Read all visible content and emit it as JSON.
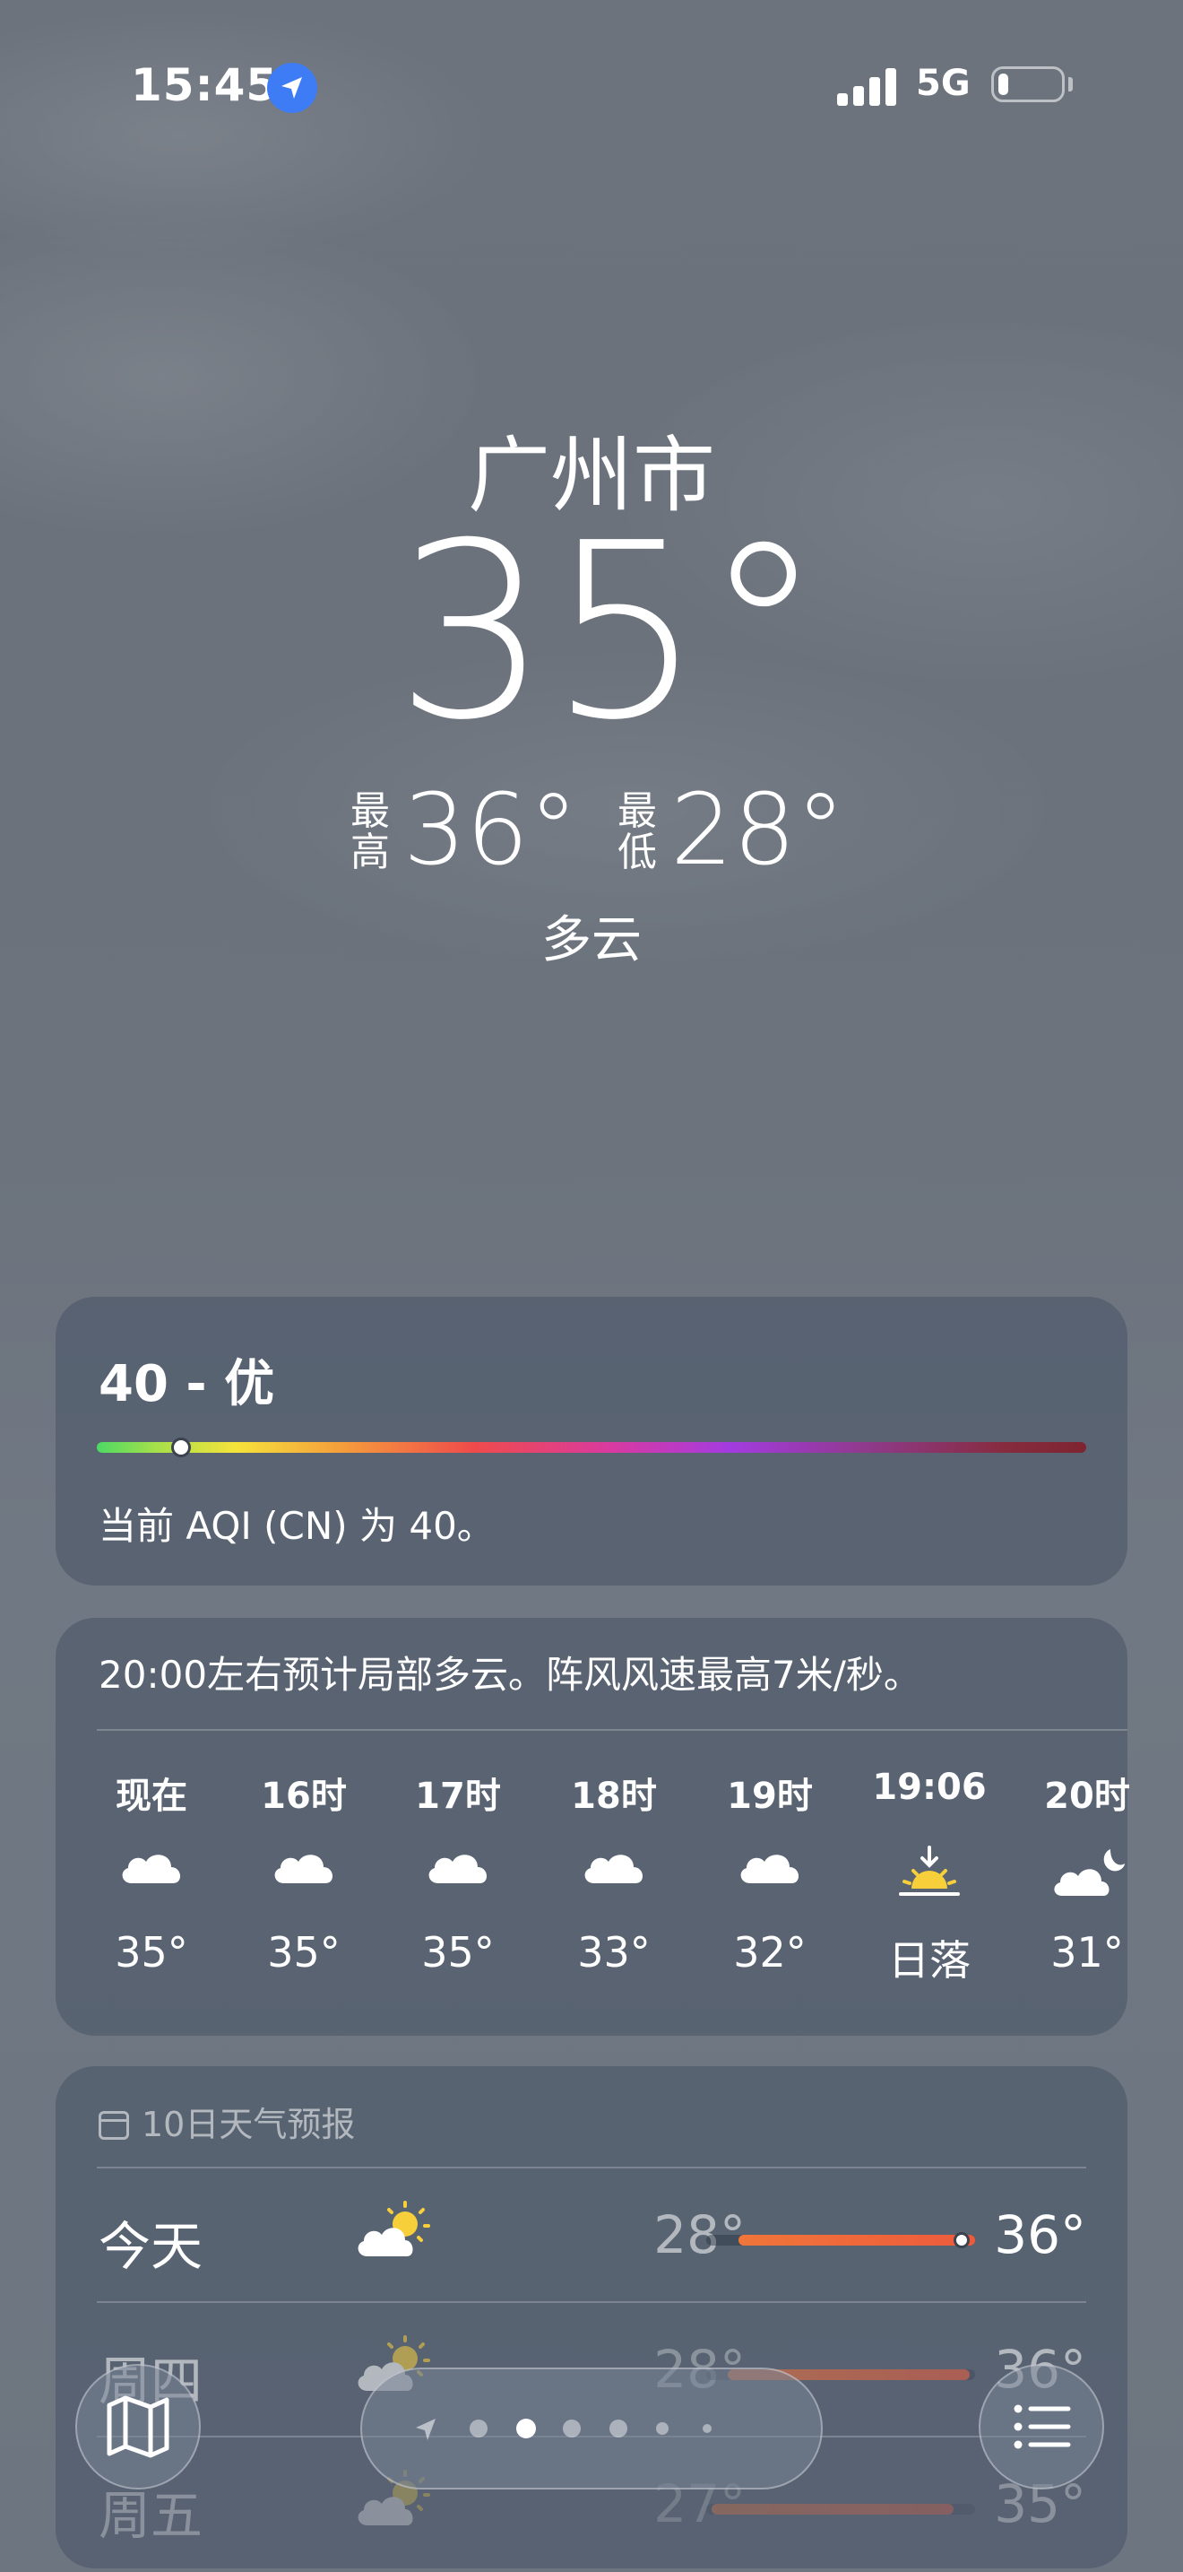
{
  "status_bar": {
    "time": "15:45",
    "network": "5G",
    "battery_level": 0.15
  },
  "hero": {
    "city": "广州市",
    "temperature": "35°",
    "high_label": "最高",
    "high": "36°",
    "low_label": "最低",
    "low": "28°",
    "condition": "多云"
  },
  "aqi": {
    "title": "40 - 优",
    "description": "当前 AQI (CN) 为 40。",
    "position": 0.085
  },
  "hourly": {
    "summary": "20:00左右预计局部多云。阵风风速最高7米/秒。",
    "items": [
      {
        "label": "现在",
        "icon": "cloud-icon",
        "temp": "35°"
      },
      {
        "label": "16时",
        "icon": "cloud-icon",
        "temp": "35°"
      },
      {
        "label": "17时",
        "icon": "cloud-icon",
        "temp": "35°"
      },
      {
        "label": "18时",
        "icon": "cloud-icon",
        "temp": "33°"
      },
      {
        "label": "19时",
        "icon": "cloud-icon",
        "temp": "32°"
      },
      {
        "label": "19:06",
        "icon": "sunset-icon",
        "temp": "日落"
      },
      {
        "label": "20时",
        "icon": "partly-cloudy-night-icon",
        "temp": "31°"
      }
    ]
  },
  "daily": {
    "header": "10日天气预报",
    "days": [
      {
        "name": "今天",
        "icon": "partly-sunny-icon",
        "low": "28°",
        "high": "36°",
        "range_start": 0.12,
        "range_end": 1.0,
        "current": 0.95
      },
      {
        "name": "周四",
        "icon": "partly-sunny-icon",
        "low": "28°",
        "high": "36°",
        "range_start": 0.08,
        "range_end": 0.98
      },
      {
        "name": "周五",
        "icon": "partly-sunny-icon",
        "low": "27°",
        "high": "35°",
        "range_start": 0.02,
        "range_end": 0.92
      }
    ]
  },
  "bottom_bar": {
    "page_count": 7,
    "active_page": 2
  },
  "colors": {
    "accent_location": "#3d7cf5",
    "sun_yellow": "#f6cf3b",
    "range_orange": "#ee5a3c"
  }
}
